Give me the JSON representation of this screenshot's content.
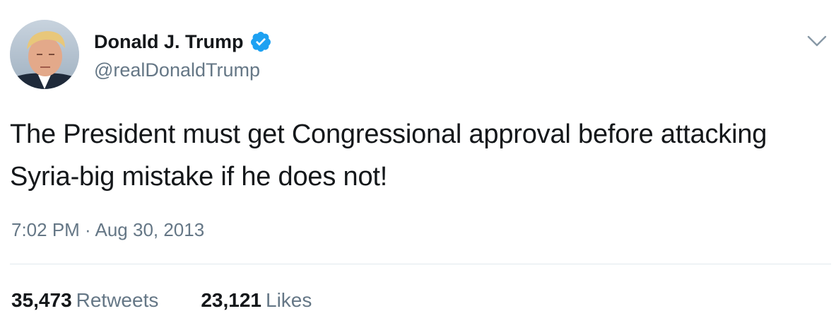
{
  "tweet": {
    "author_name": "Donald J. Trump",
    "author_handle": "@realDonaldTrump",
    "verified": true,
    "text": "The President must get Congressional approval before attacking Syria-big mistake if he does not!",
    "timestamp": "7:02 PM · Aug 30, 2013",
    "stats": {
      "retweets_count": "35,473",
      "retweets_label": "Retweets",
      "likes_count": "23,121",
      "likes_label": "Likes"
    },
    "menu_icon": "chevron-down-icon",
    "verified_icon": "verified-badge-icon"
  },
  "colors": {
    "accent": "#1da1f2",
    "text_primary": "#14171a",
    "text_secondary": "#657786",
    "divider": "#e1e8ed"
  }
}
